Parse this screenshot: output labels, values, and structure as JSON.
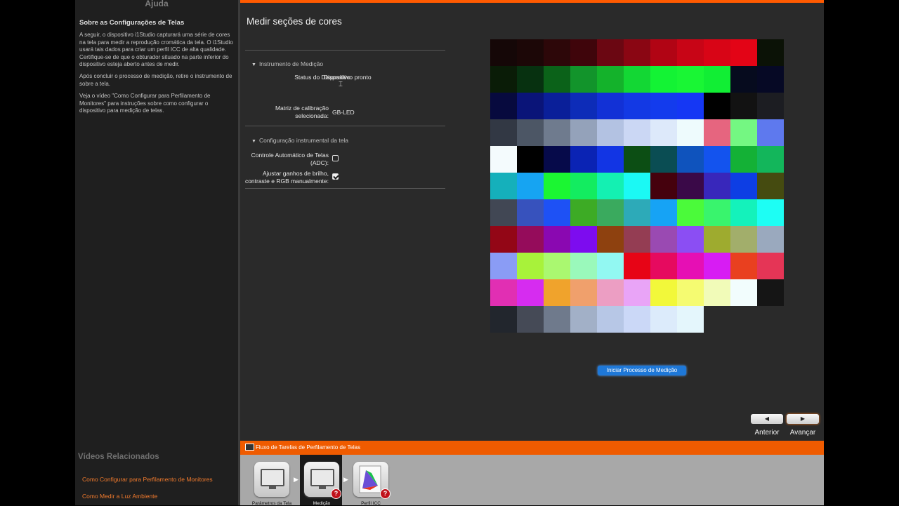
{
  "help": {
    "title": "Ajuda",
    "heading": "Sobre as Configurações de Telas",
    "p1": "A seguir, o dispositivo i1Studio capturará uma série de cores na tela para medir a reprodução cromática da tela. O i1Studio usará tais dados para criar um perfil ICC de alta qualidade. Certifique-se de que o obturador situado na parte inferior do dispositivo esteja aberto antes de medir.",
    "p2": "Após concluir o processo de medição, retire o instrumento de sobre a tela.",
    "p3": "Veja o vídeo \"Como Configurar para Perfilamento de Monitores\" para instruções sobre como configurar o dispositivo para medição de telas.",
    "related_title": "Vídeos Relacionados",
    "links": [
      "Como Configurar para Perfilamento de Monitores",
      "Como Medir a Luz Ambiente"
    ]
  },
  "main": {
    "title": "Medir seções de cores",
    "section1": "Instrumento de Medição",
    "status_label": "Status do Dispositivo:",
    "status_value": "Dispositivo pronto",
    "matrix_label_1": "Matriz de calibração",
    "matrix_label_2": "selecionada:",
    "matrix_value": "GB-LED",
    "section2": "Configuração instrumental da tela",
    "adc_label_1": "Controle Automático de Telas",
    "adc_label_2": "(ADC):",
    "adc_checked": false,
    "manual_label_1": "Ajustar ganhos de brilho,",
    "manual_label_2": "contraste e RGB manualmente:",
    "manual_checked": true,
    "measure_button": "Iniciar Processo de Medição",
    "back_label": "Anterior",
    "next_label": "Avançar"
  },
  "workflow": {
    "title": "Fluxo de Tarefas de Perfilamento de Telas",
    "steps": [
      "Parâmetros da Tela",
      "Medição",
      "Perfil ICC"
    ],
    "active_step": 1
  },
  "swatches": [
    [
      "#150707",
      "#1c0707",
      "#2d0709",
      "#3f050b",
      "#6b0712",
      "#8a0613",
      "#b10414",
      "#c80516",
      "#d80516",
      "#e30416",
      "#0b1206"
    ],
    [
      "#0a1c07",
      "#073110",
      "#0b6219",
      "#12942b",
      "#14b22b",
      "#13d734",
      "#13f334",
      "#19f634",
      "#11ee34",
      "#060b1e",
      "#060925"
    ],
    [
      "#070a3e",
      "#0a1478",
      "#0a1f99",
      "#0d2cb8",
      "#1231d6",
      "#1339e4",
      "#133bed",
      "#1537f4",
      "#000000",
      "#121212",
      "#1c1d22"
    ],
    [
      "#323844",
      "#4c5665",
      "#6f7b8e",
      "#94a2ba",
      "#b3c2e2",
      "#cbd7f4",
      "#dde9fa",
      "#eefbfd",
      "#e6657f",
      "#74f782",
      "#5e79ee"
    ],
    [
      "#f4fbfd",
      "#000000",
      "#060a4a",
      "#0a23b4",
      "#1235e4",
      "#0c4e14",
      "#0a4d53",
      "#0f53bd",
      "#1353ee",
      "#14b136",
      "#13b65b"
    ],
    [
      "#15b0bb",
      "#16a4f2",
      "#1bf632",
      "#13ec60",
      "#14f0b2",
      "#1bf9f4",
      "#45010d",
      "#3a0948",
      "#3827bb",
      "#0d3ee4",
      "#454b10"
    ],
    [
      "#414754",
      "#3752bd",
      "#1e51f5",
      "#3dab25",
      "#3aaa5e",
      "#2daab8",
      "#16a3f5",
      "#4bfa3a",
      "#39f46d",
      "#14f2bb",
      "#1dfef4"
    ],
    [
      "#930616",
      "#950c5b",
      "#8a08b1",
      "#7d0cef",
      "#8e410f",
      "#943d53",
      "#9a4ab2",
      "#8b4ef3",
      "#9eab2f",
      "#a2ae6b",
      "#9aa9be"
    ],
    [
      "#8a9cf5",
      "#a8f23a",
      "#aaf870",
      "#9af9bb",
      "#92f8f2",
      "#e70416",
      "#e60a5f",
      "#e60fb4",
      "#d71cf3",
      "#e9401f",
      "#e53556"
    ],
    [
      "#e12fb3",
      "#d62cf0",
      "#f0a32c",
      "#f0a06c",
      "#ec9ec3",
      "#e9a4f7",
      "#f2f83a",
      "#f5fb71",
      "#f1fbb8",
      "#f2fdfd",
      "#151515"
    ],
    [
      "#22262d",
      "#454a56",
      "#6f7a8c",
      "#a2b0c7",
      "#b7c7e6",
      "#cbd8f7",
      "#dcebfb",
      "#e4f6fc"
    ]
  ]
}
